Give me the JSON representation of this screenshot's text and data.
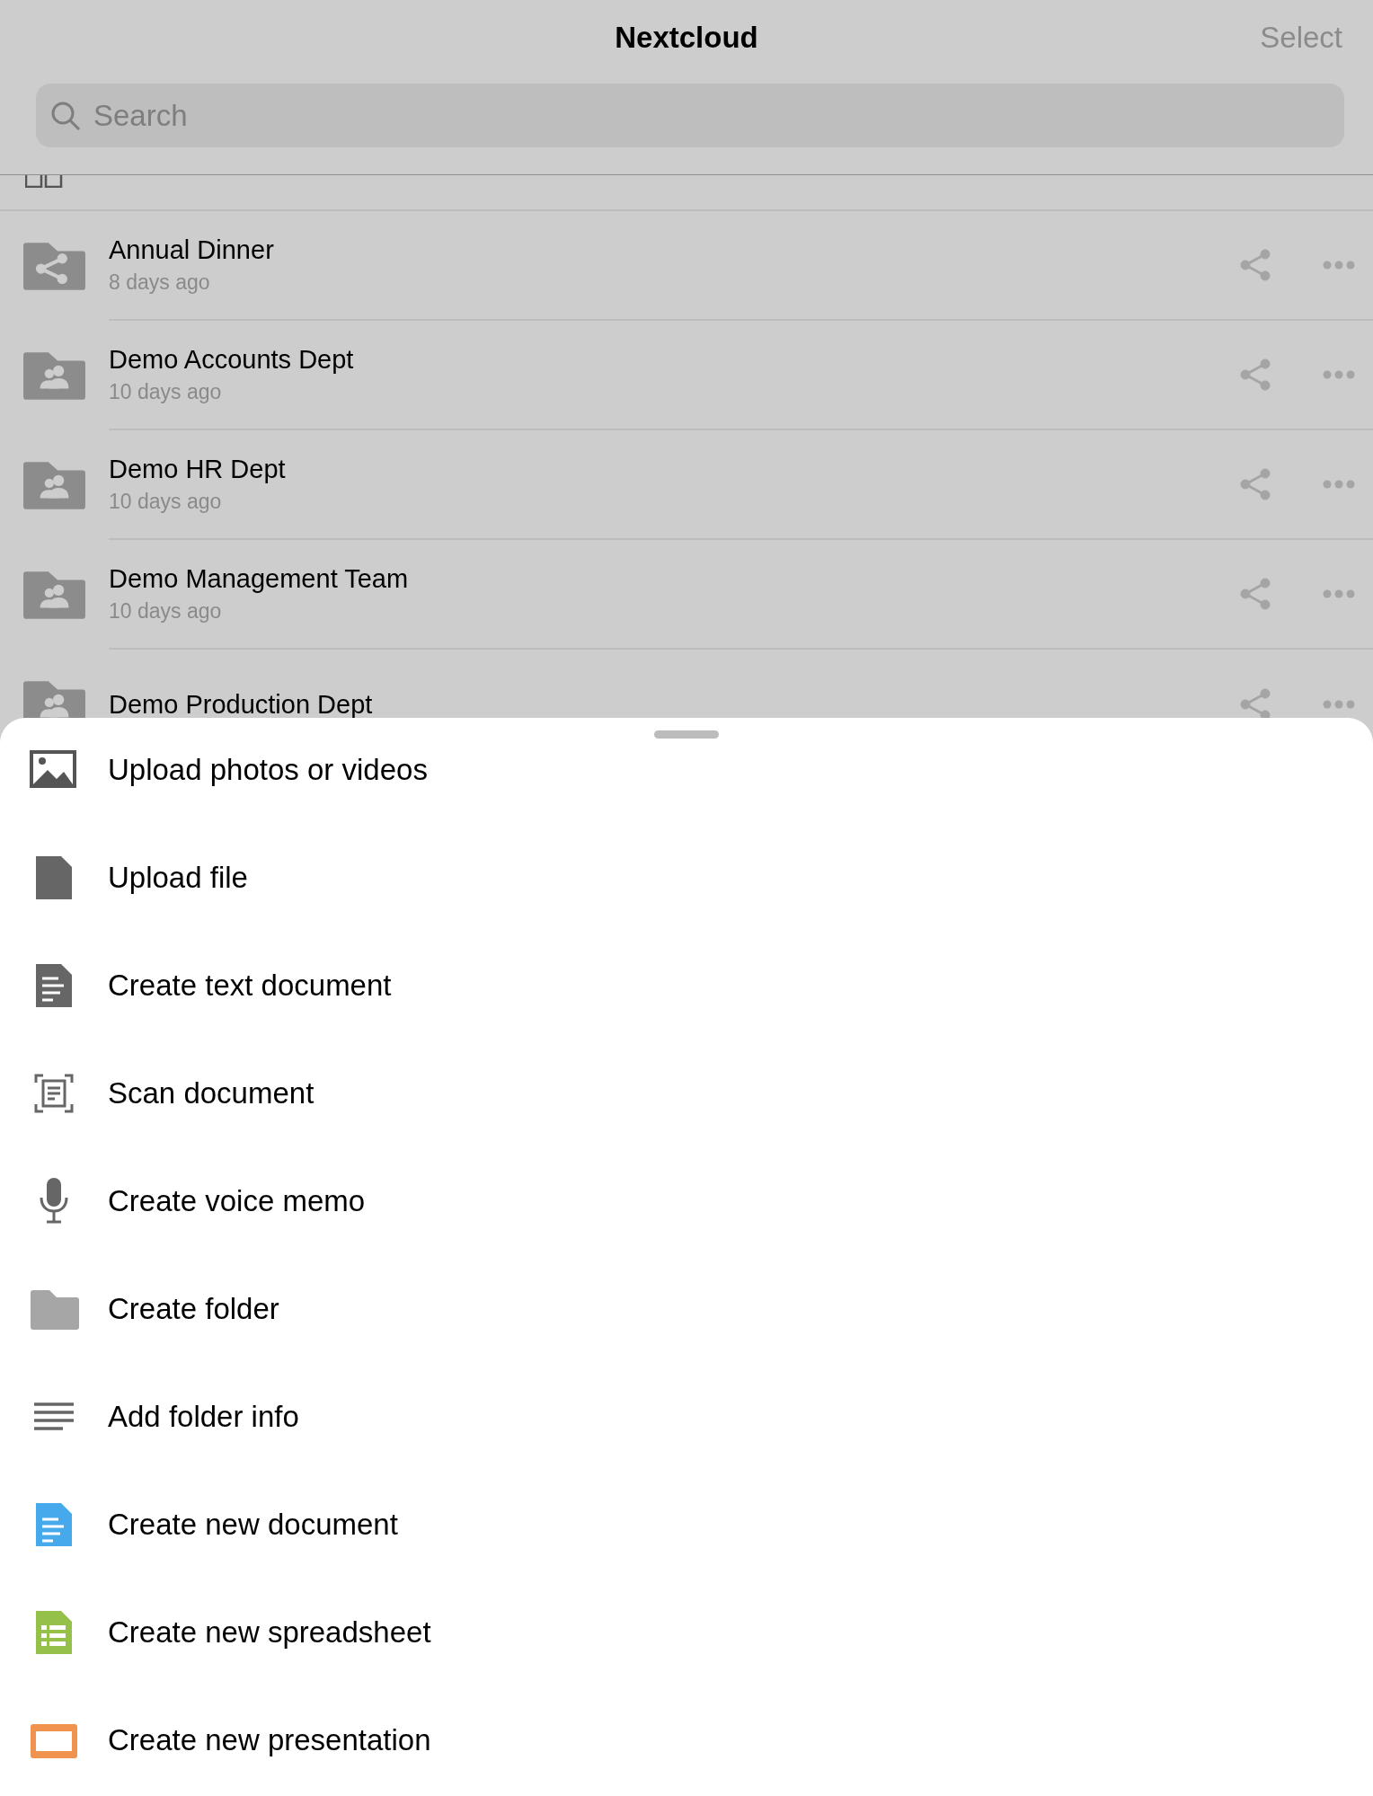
{
  "header": {
    "title": "Nextcloud",
    "action": "Select"
  },
  "search": {
    "placeholder": "Search"
  },
  "files": [
    {
      "name": "Annual Dinner",
      "modified": "8 days ago",
      "kind": "shared"
    },
    {
      "name": "Demo Accounts Dept",
      "modified": "10 days ago",
      "kind": "group"
    },
    {
      "name": "Demo HR Dept",
      "modified": "10 days ago",
      "kind": "group"
    },
    {
      "name": "Demo Management Team",
      "modified": "10 days ago",
      "kind": "group"
    },
    {
      "name": "Demo Production Dept",
      "kind": "group"
    }
  ],
  "sheet": {
    "items": [
      {
        "label": "Upload photos or videos",
        "kind": "photo"
      },
      {
        "label": "Upload file",
        "kind": "file"
      },
      {
        "label": "Create text document",
        "kind": "text"
      },
      {
        "label": "Scan document",
        "kind": "scan"
      },
      {
        "label": "Create voice memo",
        "kind": "mic"
      },
      {
        "label": "Create folder",
        "kind": "folder"
      },
      {
        "label": "Add folder info",
        "kind": "lines"
      },
      {
        "label": "Create new document",
        "kind": "document"
      },
      {
        "label": "Create new spreadsheet",
        "kind": "spreadsheet"
      },
      {
        "label": "Create new presentation",
        "kind": "presentation"
      }
    ]
  }
}
